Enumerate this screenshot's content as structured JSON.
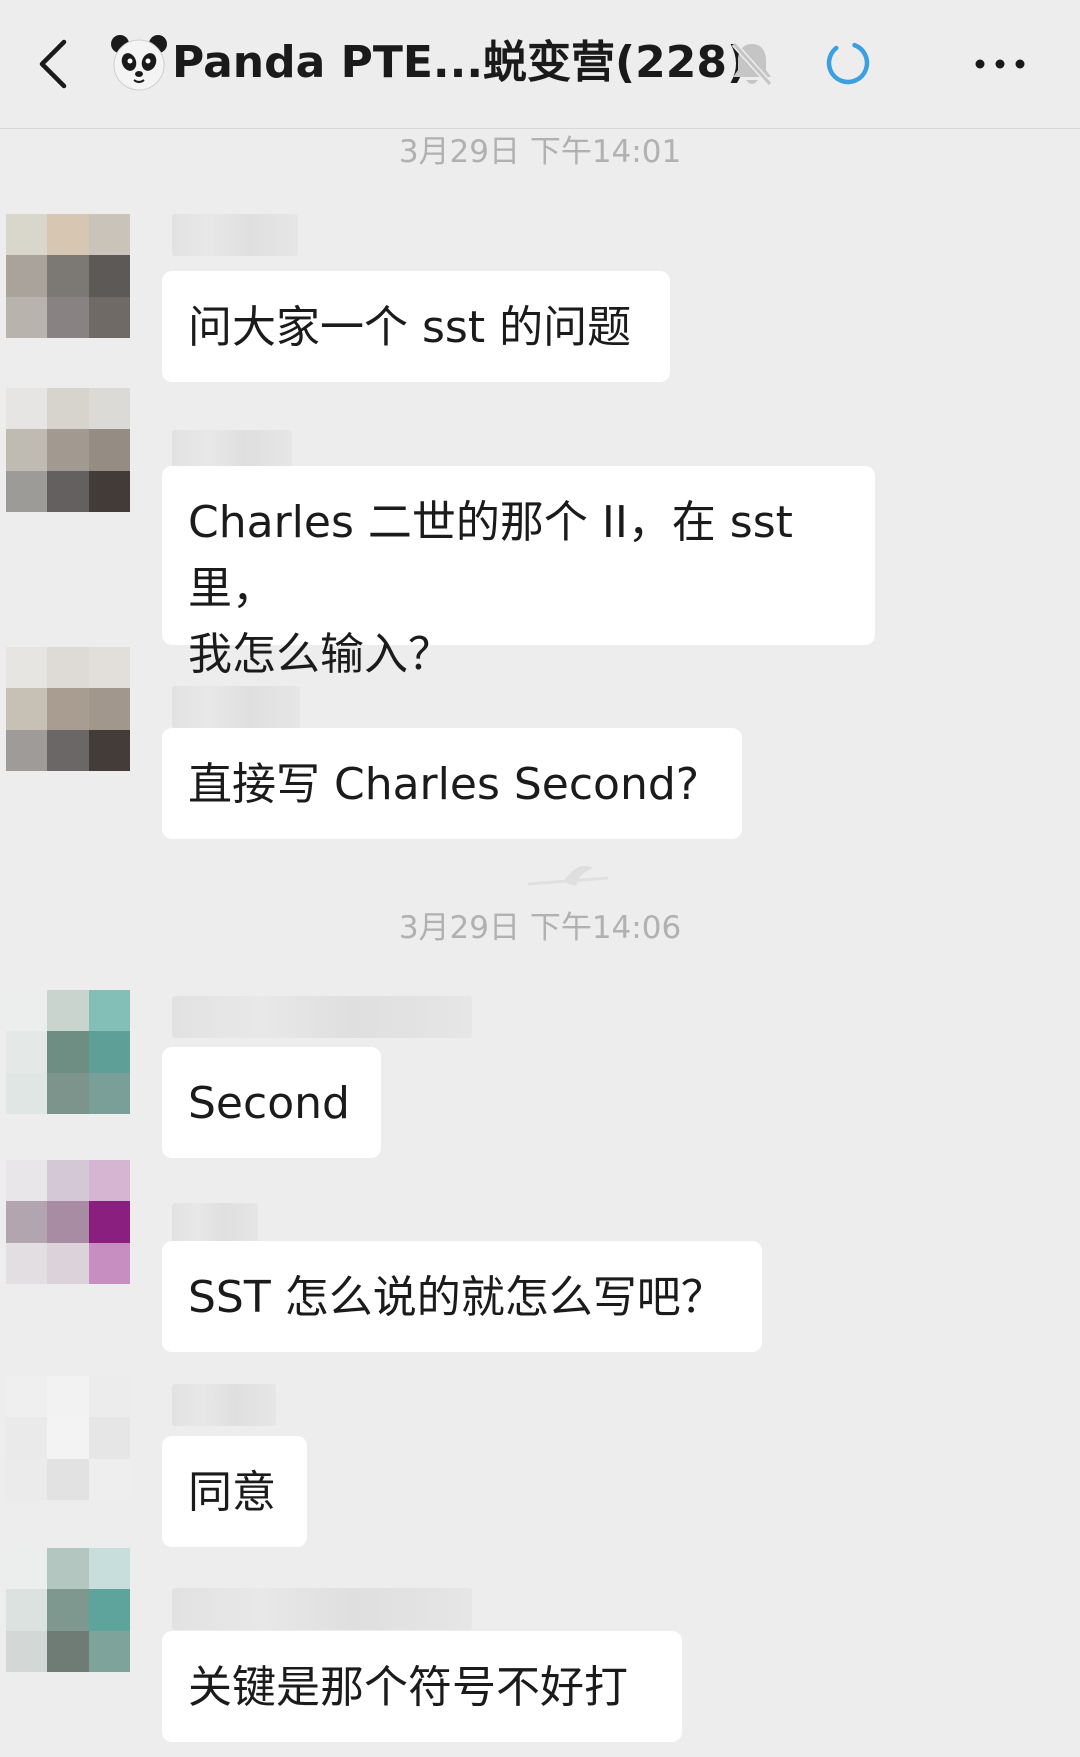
{
  "header": {
    "title": "Panda PTE...蜕变营(228)",
    "back_icon": "chevron-left-icon",
    "avatar_icon": "panda-face-icon",
    "mute_icon": "bell-off-icon",
    "status_icon": "loading-ring-icon",
    "more_icon": "ellipsis-icon",
    "accent_color": "#3aa0e0"
  },
  "timestamps": [
    "3月29日 下午14:01",
    "3月29日 下午14:06"
  ],
  "messages": [
    {
      "text": "问大家一个 sst 的问题"
    },
    {
      "text": "Charles 二世的那个 II，在 sst 里，\n我怎么输入？"
    },
    {
      "text": "直接写 Charles Second?"
    },
    {
      "text": "Second"
    },
    {
      "text": "SST 怎么说的就怎么写吧？"
    },
    {
      "text": "同意"
    },
    {
      "text": "关键是那个符号不好打"
    }
  ],
  "colors": {
    "background": "#ededed",
    "bubble": "#ffffff",
    "timestamp_text": "#b1b1b1"
  }
}
